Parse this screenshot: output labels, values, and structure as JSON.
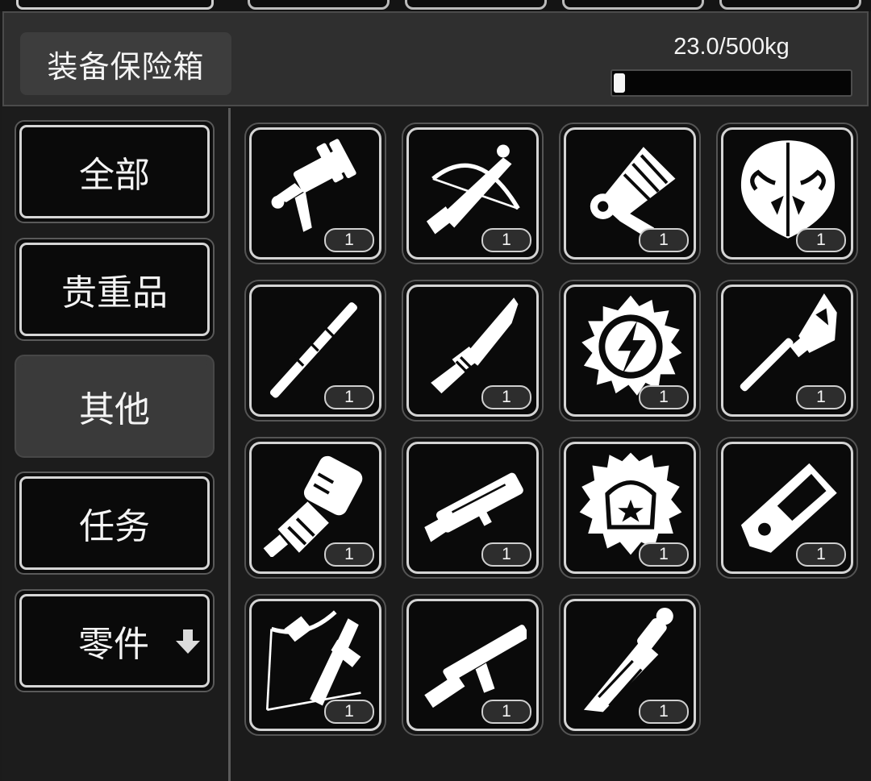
{
  "header": {
    "title": "装备保险箱",
    "weight_text": "23.0/500kg",
    "weight_fraction": 0.046
  },
  "sidebar": {
    "tabs": [
      {
        "label": "全部",
        "active": false
      },
      {
        "label": "贵重品",
        "active": false
      },
      {
        "label": "其他",
        "active": true
      },
      {
        "label": "任务",
        "active": false
      },
      {
        "label": "零件",
        "active": false,
        "icon": "arrow-down-icon"
      }
    ]
  },
  "items": [
    {
      "icon": "grenade-launcher-icon",
      "count": "1"
    },
    {
      "icon": "crossbow-icon",
      "count": "1"
    },
    {
      "icon": "megaphone-icon",
      "count": "1"
    },
    {
      "icon": "bull-shield-icon",
      "count": "1"
    },
    {
      "icon": "staff-icon",
      "count": "1"
    },
    {
      "icon": "combat-knife-icon",
      "count": "1"
    },
    {
      "icon": "lightning-emblem-icon",
      "count": "1"
    },
    {
      "icon": "glaive-icon",
      "count": "1"
    },
    {
      "icon": "power-gauntlet-icon",
      "count": "1"
    },
    {
      "icon": "rocket-launcher-icon",
      "count": "1"
    },
    {
      "icon": "star-helmet-icon",
      "count": "1"
    },
    {
      "icon": "armored-device-icon",
      "count": "1"
    },
    {
      "icon": "repeating-crossbow-icon",
      "count": "1"
    },
    {
      "icon": "shotgun-icon",
      "count": "1"
    },
    {
      "icon": "claw-blade-icon",
      "count": "1"
    }
  ]
}
